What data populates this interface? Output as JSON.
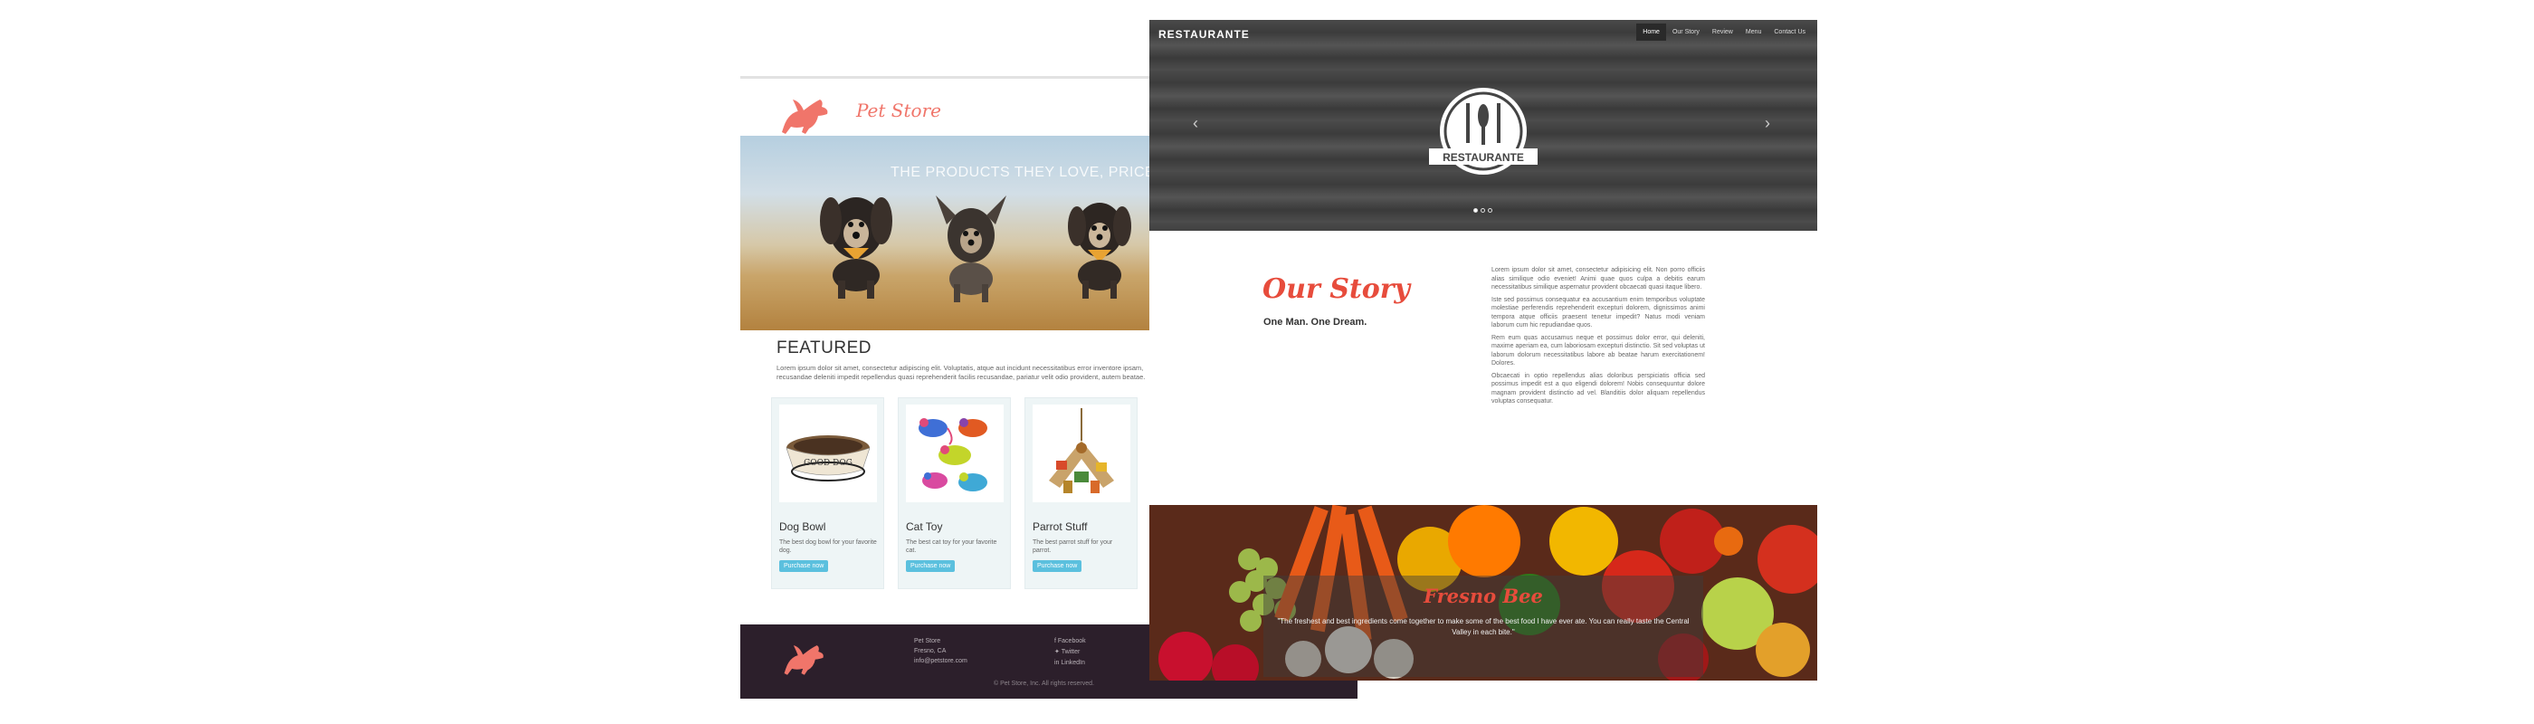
{
  "pet_store": {
    "logo_text": "Pet Store",
    "hero_tagline": "THE PRODUCTS THEY LOVE, PRICES THAT",
    "featured": {
      "title": "FEATURED",
      "text": "Lorem ipsum dolor sit amet, consectetur adipiscing elit. Voluptatis, atque aut incidunt necessitatibus error inventore ipsam, recusandae deleniti impedit repellendus quasi reprehenderit facilis recusandae, pariatur velit odio provident, autem beatae."
    },
    "products": [
      {
        "name": "Dog Bowl",
        "desc": "The best dog bowl for your favorite dog.",
        "button": "Purchase now",
        "bowl_text": "GOOD DOG"
      },
      {
        "name": "Cat Toy",
        "desc": "The best cat toy for your favorite cat.",
        "button": "Purchase now"
      },
      {
        "name": "Parrot Stuff",
        "desc": "The best parrot stuff for your parrot.",
        "button": "Purchase now"
      }
    ],
    "footer": {
      "address": [
        "Pet Store",
        "Fresno, CA",
        "info@petstore.com"
      ],
      "social": [
        "Facebook",
        "Twitter",
        "LinkedIn"
      ],
      "copyright": "© Pet Store, Inc. All rights reserved."
    }
  },
  "restaurante": {
    "brand": "RESTAURANTE",
    "nav": [
      "Home",
      "Our Story",
      "Review",
      "Menu",
      "Contact Us"
    ],
    "logo_text": "RESTAURANTE",
    "story": {
      "title": "Our Story",
      "subtitle": "One Man. One Dream.",
      "paragraphs": [
        "Lorem ipsum dolor sit amet, consectetur adipisicing elit. Non porro officiis alias similique odio eveniet! Animi quae quos culpa a debitis earum necessitatibus similique aspernatur provident obcaecati quasi itaque libero.",
        "Iste sed possimus consequatur ea accusantium enim temporibus voluptate molestiae perferendis reprehenderit excepturi dolorem, dignissimos animi tempora atque officiis praesent tenetur impedit? Natus modi veniam laborum cum hic repudiandae quos.",
        "Rem eum quas accusamus neque et possimus dolor error, qui deleniti, maxime aperiam ea, cum laboriosam excepturi distinctio. Sit sed voluptas ut laborum dolorum necessitatibus labore ab beatae harum exercitationem! Dolores.",
        "Obcaecati in optio repellendus alias doloribus perspiciatis officia sed possimus impedit est a quo eligendi dolorem! Nobis consequuntur dolore magnam provident distinctio ad vel. Blanditiis dolor aliquam repellendus voluptas consequatur."
      ]
    },
    "review": {
      "title": "Fresno Bee",
      "quote": "\"The freshest and best ingredients come together to make some of the best food I have ever ate. You can really taste the Central Valley in each bite.\""
    }
  },
  "colors": {
    "pet_accent": "#f0756a",
    "button_blue": "#5bc0de",
    "footer_bg": "#2c1f2b",
    "restaurant_red": "#e74c3c"
  }
}
